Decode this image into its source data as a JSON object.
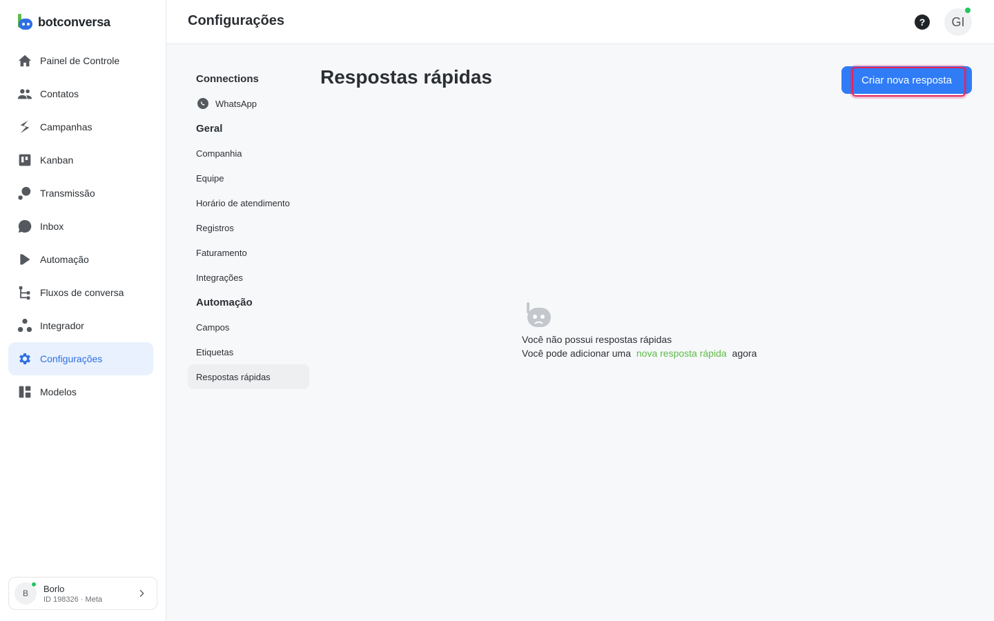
{
  "brand": {
    "name": "botconversa"
  },
  "colors": {
    "accent": "#2f7cf6",
    "brand_green": "#5dbb46",
    "active_bg": "#e8f1fd",
    "online": "#22c55e",
    "focus": "#e0245e"
  },
  "sidebar": {
    "items": [
      {
        "label": "Painel de Controle",
        "icon": "home-icon"
      },
      {
        "label": "Contatos",
        "icon": "users-icon"
      },
      {
        "label": "Campanhas",
        "icon": "campaign-icon"
      },
      {
        "label": "Kanban",
        "icon": "kanban-icon"
      },
      {
        "label": "Transmissão",
        "icon": "broadcast-icon"
      },
      {
        "label": "Inbox",
        "icon": "chat-bubble-icon"
      },
      {
        "label": "Automação",
        "icon": "play-icon"
      },
      {
        "label": "Fluxos de conversa",
        "icon": "flow-icon"
      },
      {
        "label": "Integrador",
        "icon": "integrator-icon"
      },
      {
        "label": "Configurações",
        "icon": "gear-icon",
        "active": true
      },
      {
        "label": "Modelos",
        "icon": "templates-icon"
      }
    ]
  },
  "workspace": {
    "initial": "B",
    "name": "Borlo",
    "sub": "ID 198326 · Meta"
  },
  "header": {
    "title": "Configurações",
    "user_initials": "GI"
  },
  "subnav": {
    "connections_heading": "Connections",
    "whatsapp": "WhatsApp",
    "geral_heading": "Geral",
    "geral_items": [
      "Companhia",
      "Equipe",
      "Horário de atendimento",
      "Registros",
      "Faturamento",
      "Integrações"
    ],
    "automacao_heading": "Automação",
    "automacao_items": [
      "Campos",
      "Etiquetas",
      "Respostas rápidas"
    ]
  },
  "main": {
    "title": "Respostas rápidas",
    "create_button": "Criar nova resposta",
    "empty_line1": "Você não possui respostas rápidas",
    "empty_line2_pre": "Você pode adicionar uma",
    "empty_link": "nova resposta rápida",
    "empty_line2_post": "agora"
  }
}
